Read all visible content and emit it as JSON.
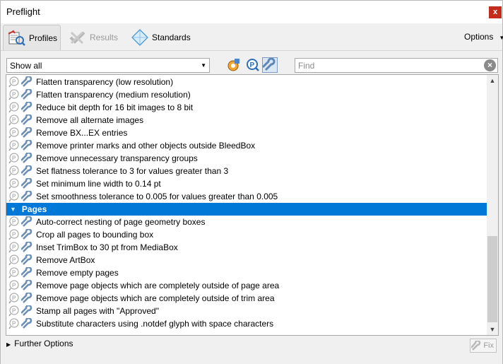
{
  "window": {
    "title": "Preflight",
    "close_label": "x"
  },
  "tabs": [
    {
      "label": "Profiles",
      "icon": "profiles-icon",
      "active": true
    },
    {
      "label": "Results",
      "icon": "results-icon",
      "active": false
    },
    {
      "label": "Standards",
      "icon": "standards-icon",
      "active": false
    }
  ],
  "options_label": "Options",
  "toolbar": {
    "filter_value": "Show all",
    "search_placeholder": "Find"
  },
  "list": {
    "rows": [
      {
        "type": "item",
        "label": "Flatten transparency (low resolution)"
      },
      {
        "type": "item",
        "label": "Flatten transparency (medium resolution)"
      },
      {
        "type": "item",
        "label": "Reduce bit depth for 16 bit images to 8 bit"
      },
      {
        "type": "item",
        "label": "Remove all alternate images"
      },
      {
        "type": "item",
        "label": "Remove BX...EX entries"
      },
      {
        "type": "item",
        "label": "Remove printer marks and other objects outside BleedBox"
      },
      {
        "type": "item",
        "label": "Remove unnecessary transparency groups"
      },
      {
        "type": "item",
        "label": "Set flatness tolerance to 3 for values greater than 3"
      },
      {
        "type": "item",
        "label": "Set minimum line width to 0.14 pt"
      },
      {
        "type": "item",
        "label": "Set smoothness tolerance to 0.005 for values greater than 0.005"
      },
      {
        "type": "section",
        "label": "Pages"
      },
      {
        "type": "item",
        "label": "Auto-correct nesting of page geometry boxes"
      },
      {
        "type": "item",
        "label": "Crop all pages to bounding box"
      },
      {
        "type": "item",
        "label": "Inset TrimBox to 30 pt from MediaBox"
      },
      {
        "type": "item",
        "label": "Remove ArtBox"
      },
      {
        "type": "item",
        "label": "Remove empty pages"
      },
      {
        "type": "item",
        "label": "Remove page objects which are completely outside of page area"
      },
      {
        "type": "item",
        "label": "Remove page objects which are completely outside of trim area"
      },
      {
        "type": "item",
        "label": "Stamp all pages with \"Approved\""
      },
      {
        "type": "item",
        "label": "Substitute characters using .notdef glyph with space characters"
      }
    ]
  },
  "footer": {
    "further_options_label": "Further Options",
    "fix_label": "Fix"
  },
  "colors": {
    "selection": "#0078d7",
    "close": "#c42b1c"
  }
}
